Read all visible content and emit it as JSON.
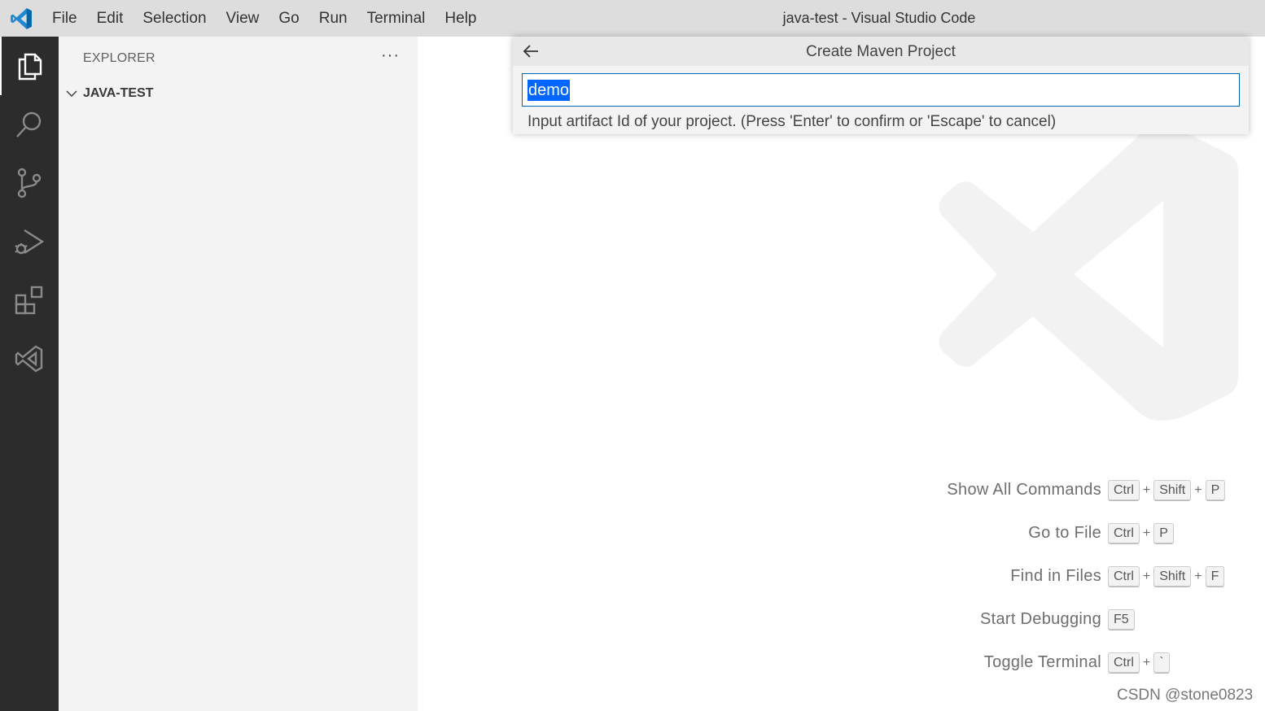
{
  "titlebar": {
    "menu": [
      "File",
      "Edit",
      "Selection",
      "View",
      "Go",
      "Run",
      "Terminal",
      "Help"
    ],
    "window_title": "java-test - Visual Studio Code"
  },
  "activitybar": {
    "icons": [
      "explorer-icon",
      "search-icon",
      "source-control-icon",
      "run-debug-icon",
      "extensions-icon",
      "remote-explorer-icon"
    ],
    "active": "explorer-icon"
  },
  "sidebar": {
    "title": "EXPLORER",
    "more_label": "···",
    "folder": "JAVA-TEST"
  },
  "quick_input": {
    "title": "Create Maven Project",
    "value": "demo",
    "message": "Input artifact Id of your project. (Press 'Enter' to confirm or 'Escape' to cancel)"
  },
  "shortcuts": [
    {
      "label": "Show All Commands",
      "keys": [
        "Ctrl",
        "Shift",
        "P"
      ]
    },
    {
      "label": "Go to File",
      "keys": [
        "Ctrl",
        "P"
      ]
    },
    {
      "label": "Find in Files",
      "keys": [
        "Ctrl",
        "Shift",
        "F"
      ]
    },
    {
      "label": "Start Debugging",
      "keys": [
        "F5"
      ]
    },
    {
      "label": "Toggle Terminal",
      "keys": [
        "Ctrl",
        "`"
      ]
    }
  ],
  "watermark_text": "CSDN @stone0823",
  "colors": {
    "titlebar": "#dddddd",
    "activitybar": "#2c2c2c",
    "sidebar": "#f3f3f3",
    "accent": "#0066b8",
    "selection": "#0066ff"
  }
}
